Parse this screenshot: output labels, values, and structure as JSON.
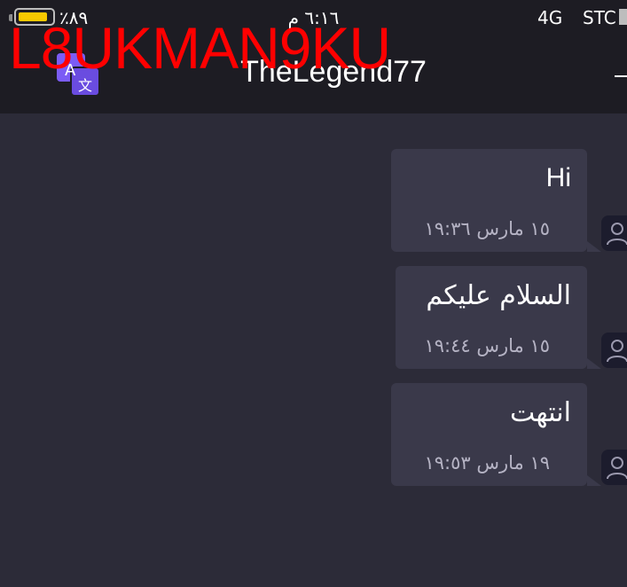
{
  "status_bar": {
    "battery_percent": "٪٨٩",
    "battery_level": 0.89,
    "time": "٦:١٦ م",
    "network": "4G",
    "carrier": "STC"
  },
  "header": {
    "title": "TheLegend77",
    "translate_icon_letters": "A 文"
  },
  "watermark": "L8UKMAN9KU",
  "messages": [
    {
      "text": "Hi",
      "time": "١٥ مارس ١٩:٣٦"
    },
    {
      "text": "السلام عليكم",
      "time": "١٥ مارس ١٩:٤٤"
    },
    {
      "text": "انتهت",
      "time": "١٩ مارس ١٩:٥٣"
    }
  ],
  "colors": {
    "background": "#2c2b38",
    "header": "#1d1c23",
    "bubble": "#3a394a",
    "battery": "#f7c800",
    "watermark": "#ff0000",
    "translate_icon": "#7b5cf5"
  }
}
